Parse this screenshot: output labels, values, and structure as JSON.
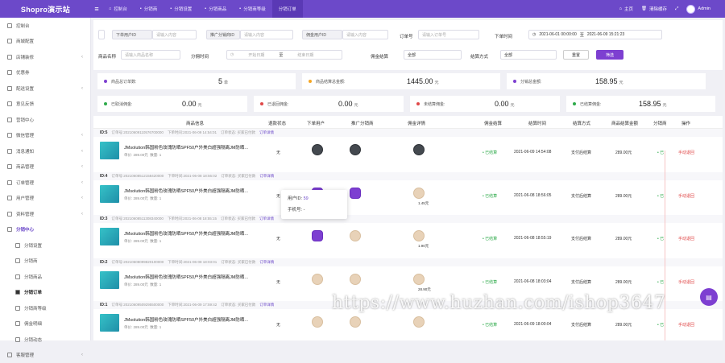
{
  "header": {
    "brand": "Shopro演示站",
    "menu": [
      "控制台",
      "分销商",
      "分销设置",
      "分销商品",
      "分销商等级",
      "分销订单"
    ],
    "active_index": 5,
    "right": {
      "home": "主页",
      "clear_cache": "清除缓存",
      "user": "Admin"
    }
  },
  "sidebar": {
    "items": [
      {
        "label": "控制台"
      },
      {
        "label": "商城配置"
      },
      {
        "label": "店铺装修",
        "arrow": true
      },
      {
        "label": "优惠券"
      },
      {
        "label": "配送设置",
        "arrow": true
      },
      {
        "label": "意见反馈"
      },
      {
        "label": "营销中心"
      },
      {
        "label": "微信管理",
        "arrow": true
      },
      {
        "label": "消息通知",
        "arrow": true
      },
      {
        "label": "商品管理",
        "arrow": true
      },
      {
        "label": "订单管理",
        "arrow": true
      },
      {
        "label": "用户管理",
        "arrow": true
      },
      {
        "label": "资料管理",
        "arrow": true
      },
      {
        "label": "分销中心",
        "group": true
      },
      {
        "label": "分销设置",
        "sub": true
      },
      {
        "label": "分销商",
        "sub": true
      },
      {
        "label": "分销商品",
        "sub": true
      },
      {
        "label": "分销订单",
        "sub": true,
        "active": true
      },
      {
        "label": "分销商等级",
        "sub": true
      },
      {
        "label": "佣金明细",
        "sub": true
      },
      {
        "label": "分销动态",
        "sub": true
      },
      {
        "label": "客服管理",
        "arrow": true
      }
    ]
  },
  "filter": {
    "buyer_select": "下单用户ID",
    "buyer_placeholder": "请输入内容",
    "agent_select": "推广分销商ID",
    "agent_placeholder": "请输入内容",
    "goods_select": "佣金用户ID",
    "goods_placeholder": "请输入内容",
    "order_label": "订单号",
    "order_placeholder": "请输入订单号",
    "time_label": "下单时间",
    "time_start": "2021-06-01 00:00:00",
    "time_sep": "至",
    "time_end": "2021-06-09 15:21:23",
    "goods_name_label": "商品名称",
    "goods_name_placeholder": "请输入商品名称",
    "settle_time_label": "分佣时间",
    "settle_start_placeholder": "开始日期",
    "settle_sep": "至",
    "settle_end_placeholder": "结束日期",
    "commission_label": "佣金结算",
    "commission_value": "全部",
    "settle_way_label": "结算方式",
    "settle_way_value": "全部",
    "reset": "重置",
    "submit": "筛选"
  },
  "stats": [
    {
      "label": "商品总订单数:",
      "value": "5",
      "unit": "单",
      "color": "#7d3fd1"
    },
    {
      "label": "商品结算总金额:",
      "value": "1445.00",
      "unit": "元",
      "color": "#f5a623"
    },
    {
      "label": "分销总金额:",
      "value": "158.95",
      "unit": "元",
      "color": "#7d3fd1"
    },
    {
      "label": "已取消佣金:",
      "value": "0.00",
      "unit": "元",
      "color": "#2eaa4a"
    },
    {
      "label": "已退回佣金:",
      "value": "0.00",
      "unit": "元",
      "color": "#e04848"
    },
    {
      "label": "未结算佣金:",
      "value": "0.00",
      "unit": "元",
      "color": "#e04848"
    },
    {
      "label": "已结算佣金:",
      "value": "158.95",
      "unit": "元",
      "color": "#2eaa4a"
    }
  ],
  "table": {
    "headers": [
      "商品信息",
      "退款状态",
      "下单用户",
      "推广分销商",
      "佣金详情",
      "佣金结算",
      "结算时间",
      "结算方式",
      "商品结算金额",
      "分销商",
      "操作"
    ],
    "rows": [
      {
        "id": "ID:5",
        "order_no": "订单号:20210609110576700000",
        "order_time": "下单时间:2021-06-09 14:54:01",
        "order_status": "订单状态: 买家已付款",
        "detail": "订单详情",
        "product": "JMsolution韩国粉色玫瑰防晒SPF50户外美白超强隔离JM防晒...",
        "price": "单价: 289.00元",
        "qty": "数量: 1",
        "refund": "无",
        "settle": "• 已结算",
        "settle_time": "2021-06-09 14:54:08",
        "settle_way": "支付后结算",
        "amount": "289.00元",
        "agent": "• 已",
        "action": "手动退回"
      },
      {
        "id": "ID:4",
        "order_no": "订单号:20210608512158420000",
        "order_time": "下单时间:2021-06-08 18:56:02",
        "order_status": "订单状态: 买家已付款",
        "detail": "订单详情",
        "product": "JMsolution韩国粉色玫瑰防晒SPF50户外美白超强隔离JM防晒...",
        "price": "单价: 289.00元",
        "qty": "数量: 1",
        "refund": "无",
        "settle": "• 已结算",
        "settle_time": "2021-06-08 18:56:05",
        "settle_way": "支付后结算",
        "amount": "289.00元",
        "agent": "• 已",
        "action": "手动退回",
        "commission_note": "1.45元"
      },
      {
        "id": "ID:3",
        "order_no": "订单号:20210608511308340000",
        "order_time": "下单时间:2021-06-08 18:55:15",
        "order_status": "订单状态: 买家已付款",
        "detail": "订单详情",
        "product": "JMsolution韩国粉色玫瑰防晒SPF50户外美白超强隔离JM防晒...",
        "price": "单价: 289.00元",
        "qty": "数量: 1",
        "refund": "无",
        "settle": "• 已结算",
        "settle_time": "2021-06-08 18:55:19",
        "settle_way": "支付后结算",
        "amount": "289.00元",
        "agent": "• 已",
        "action": "手动退回",
        "commission_note": "1.90元"
      },
      {
        "id": "ID:2",
        "order_no": "订单号:20210608099820100000",
        "order_time": "下单时间:2021-06-08 18:03:01",
        "order_status": "订单状态: 买家已付款",
        "detail": "订单详情",
        "product": "JMsolution韩国粉色玫瑰防晒SPF50户外美白超强隔离JM防晒...",
        "price": "单价: 289.00元",
        "qty": "数量: 1",
        "refund": "无",
        "settle": "• 已结算",
        "settle_time": "2021-06-08 18:03:04",
        "settle_way": "支付后结算",
        "amount": "289.00元",
        "agent": "• 已",
        "action": "手动退回",
        "commission_note": "28.90元"
      },
      {
        "id": "ID:1",
        "order_no": "订单号:20210609509295500000",
        "order_time": "下单时间:2021-06-09 17:59:42",
        "order_status": "订单状态: 买家已付款",
        "detail": "订单详情",
        "product": "JMsolution韩国粉色玫瑰防晒SPF50户外美白超强隔离JM防晒...",
        "price": "单价: 289.00元",
        "qty": "数量: 1",
        "refund": "无",
        "settle": "• 已结算",
        "settle_time": "2021-06-09 18:00:04",
        "settle_way": "支付后结算",
        "amount": "289.00元",
        "agent": "• 已",
        "action": "手动退回"
      }
    ]
  },
  "popover": {
    "user_id_label": "用户ID:",
    "user_id": "59",
    "phone_label": "手机号:",
    "phone": "-"
  },
  "watermark": "https://www.huzhan.com/ishop3647"
}
